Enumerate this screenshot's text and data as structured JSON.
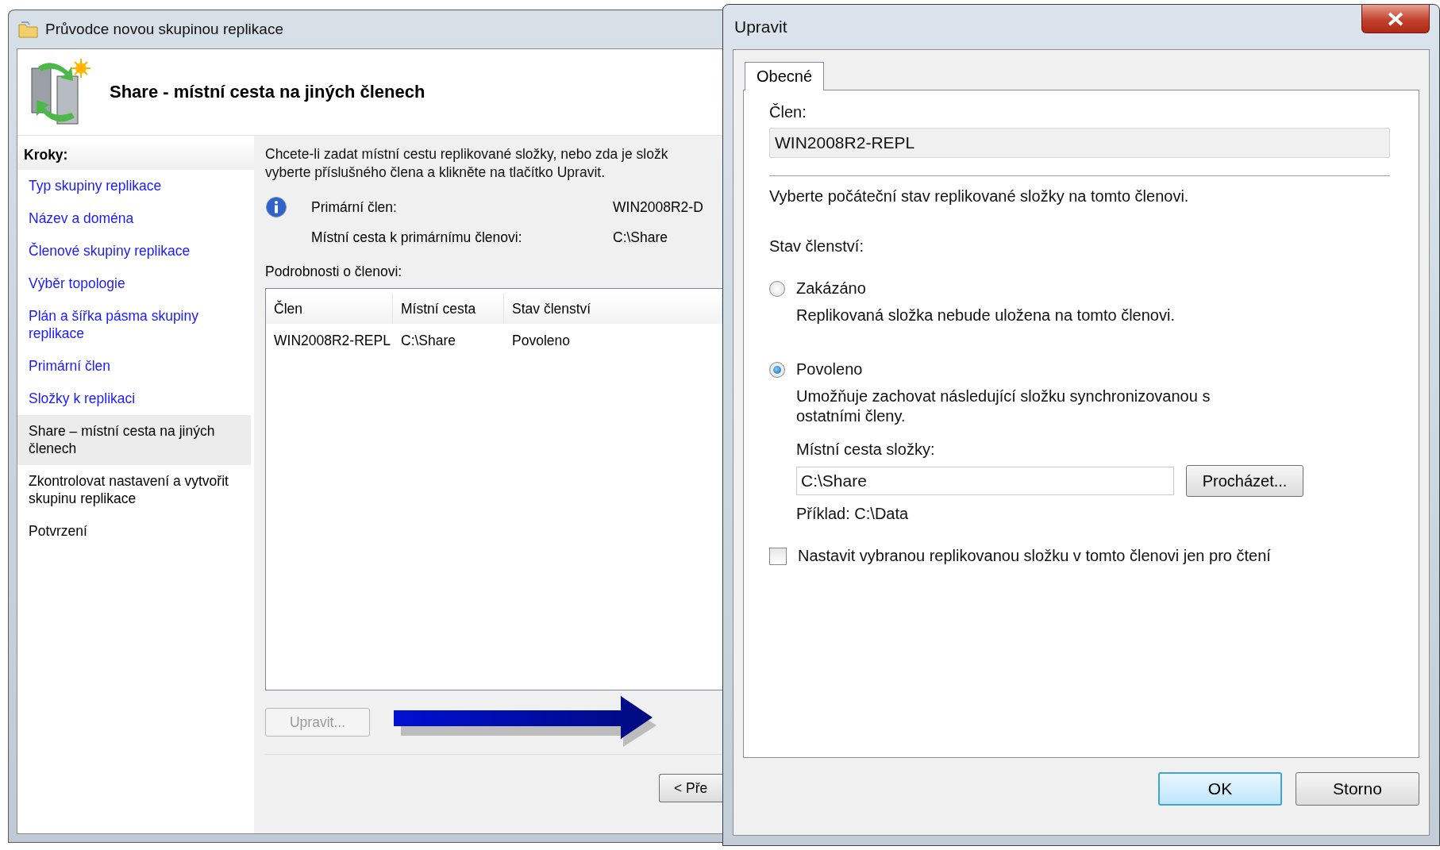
{
  "wizard": {
    "title": "Průvodce novou skupinou replikace",
    "header": "Share - místní cesta na jiných členech",
    "steps_label": "Kroky:",
    "steps": [
      {
        "label": "Typ skupiny replikace",
        "done": true,
        "selected": false
      },
      {
        "label": "Název a doména",
        "done": true,
        "selected": false
      },
      {
        "label": "Členové skupiny replikace",
        "done": true,
        "selected": false
      },
      {
        "label": "Výběr topologie",
        "done": true,
        "selected": false
      },
      {
        "label": "Plán a šířka pásma skupiny replikace",
        "done": true,
        "selected": false
      },
      {
        "label": "Primární člen",
        "done": true,
        "selected": false
      },
      {
        "label": "Složky k replikaci",
        "done": true,
        "selected": false
      },
      {
        "label": "Share – místní cesta na jiných členech",
        "done": false,
        "selected": true
      },
      {
        "label": "Zkontrolovat nastavení a vytvořit skupinu replikace",
        "done": false,
        "selected": false
      },
      {
        "label": "Potvrzení",
        "done": false,
        "selected": false
      }
    ],
    "intro_lines": [
      "Chcete-li zadat místní cestu replikované složky, nebo zda je složk",
      "vyberte příslušného člena a klikněte na tlačítko Upravit."
    ],
    "info": [
      {
        "label": "Primární člen:",
        "value": "WIN2008R2-D"
      },
      {
        "label": "Místní cesta k primárnímu členovi:",
        "value": "C:\\Share"
      }
    ],
    "members_label": "Podrobnosti o členovi:",
    "columns": [
      "Člen",
      "Místní cesta",
      "Stav členství"
    ],
    "rows": [
      [
        "WIN2008R2-REPL",
        "C:\\Share",
        "Povoleno"
      ]
    ],
    "edit_button": {
      "label": "Upravit...",
      "disabled": true
    },
    "back_button": "< Pře"
  },
  "dialog": {
    "title": "Upravit",
    "tabs": [
      {
        "label": "Obecné",
        "selected": true
      }
    ],
    "member_label": "Člen:",
    "member_value": "WIN2008R2-REPL",
    "instruction": "Vyberte počáteční stav replikované složky na tomto členovi.",
    "state_label": "Stav členství:",
    "options": [
      {
        "label": "Zakázáno",
        "description": "Replikovaná složka nebude uložena na tomto členovi.",
        "selected": false
      },
      {
        "label": "Povoleno",
        "description": "Umožňuje zachovat následující složku synchronizovanou s ostatními členy.",
        "selected": true
      }
    ],
    "path_label": "Místní cesta složky:",
    "path_value": "C:\\Share",
    "browse_button": "Procházet...",
    "example": "Příklad: C:\\Data",
    "read_only": {
      "label": "Nastavit vybranou replikovanou složku v tomto členovi jen pro čtení",
      "checked": false
    },
    "buttons": [
      {
        "label": "OK",
        "default": true
      },
      {
        "label": "Storno",
        "default": false
      }
    ]
  }
}
